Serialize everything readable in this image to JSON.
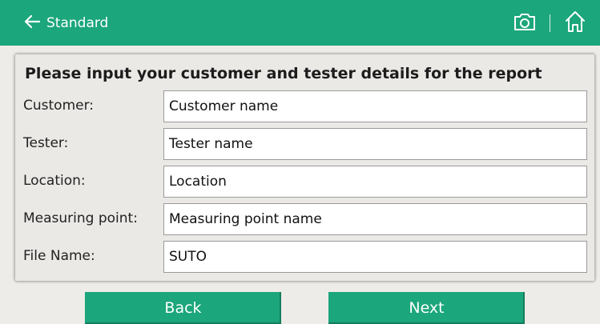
{
  "header": {
    "back_label": "Standard",
    "icons": [
      "back-arrow-icon",
      "camera-icon",
      "home-icon"
    ]
  },
  "panel": {
    "title": "Please input your customer and tester details for the report",
    "fields": [
      {
        "label": "Customer:",
        "value": "Customer name"
      },
      {
        "label": "Tester:",
        "value": "Tester name"
      },
      {
        "label": "Location:",
        "value": "Location"
      },
      {
        "label": "Measuring point:",
        "value": "Measuring point name"
      },
      {
        "label": "File Name:",
        "value": "SUTO"
      }
    ]
  },
  "buttons": {
    "back": "Back",
    "next": "Next"
  },
  "colors": {
    "accent": "#1ba67b",
    "background": "#eeece8"
  }
}
